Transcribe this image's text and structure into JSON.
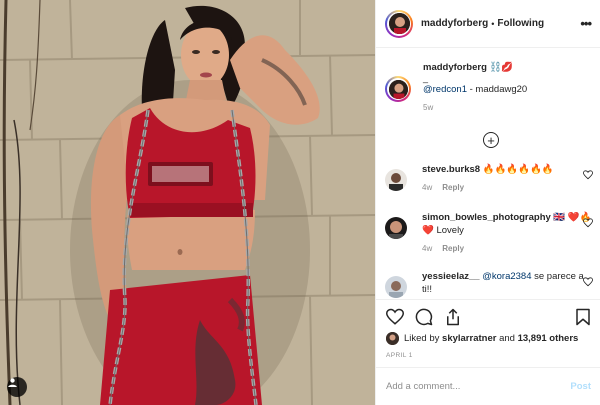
{
  "header": {
    "username": "maddyforberg",
    "separator": "•",
    "follow_state": "Following",
    "more_icon": "more-horizontal-icon"
  },
  "caption": {
    "username": "maddyforberg",
    "emojis": "⛓️💋",
    "dash": "_",
    "mention": "@redcon1",
    "rest": " - maddawg20",
    "time_ago": "5w"
  },
  "load_more_icon": "plus-circle-icon",
  "comments": [
    {
      "username": "steve.burks8",
      "text": " 🔥🔥🔥🔥🔥🔥",
      "time_ago": "4w",
      "reply": "Reply"
    },
    {
      "username": "simon_bowles_photography",
      "text": " 🇬🇧 ❤️🔥❤️ Lovely",
      "time_ago": "4w",
      "reply": "Reply"
    },
    {
      "username": "yessieelaz__",
      "mention": "@kora2384",
      "text": " se parece a ti!!"
    }
  ],
  "likes": {
    "prefix": "Liked by ",
    "user": "skylarratner",
    "middle": " and ",
    "count": "13,891 others"
  },
  "date": "APRIL 1",
  "add_comment": {
    "placeholder": "Add a comment...",
    "post_label": "Post"
  },
  "colors": {
    "link": "#00376b",
    "muted": "#8e8e8e",
    "post_disabled": "#b2dffc",
    "top_red": "#b8162a"
  }
}
